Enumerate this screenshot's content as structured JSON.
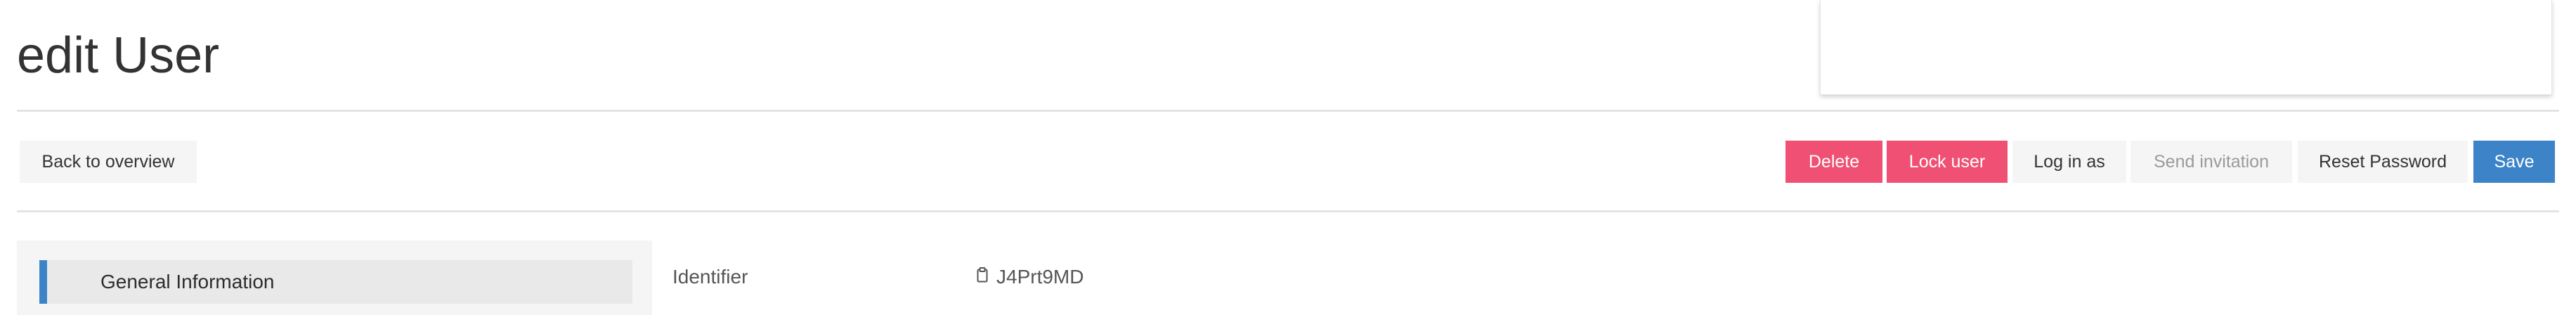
{
  "page": {
    "title": "edit User"
  },
  "toolbar": {
    "back_label": "Back to overview",
    "delete_label": "Delete",
    "lock_label": "Lock user",
    "login_as_label": "Log in as",
    "send_invitation_label": "Send invitation",
    "reset_password_label": "Reset Password",
    "save_label": "Save"
  },
  "sidebar": {
    "items": [
      {
        "label": "General Information",
        "active": true
      }
    ]
  },
  "fields": {
    "identifier": {
      "label": "Identifier",
      "value": "J4Prt9MD",
      "icon": "clipboard-icon"
    }
  },
  "colors": {
    "danger": "#ef5073",
    "primary": "#3d83c8",
    "light": "#f5f5f5",
    "disabled_text": "#9a9a9a"
  }
}
